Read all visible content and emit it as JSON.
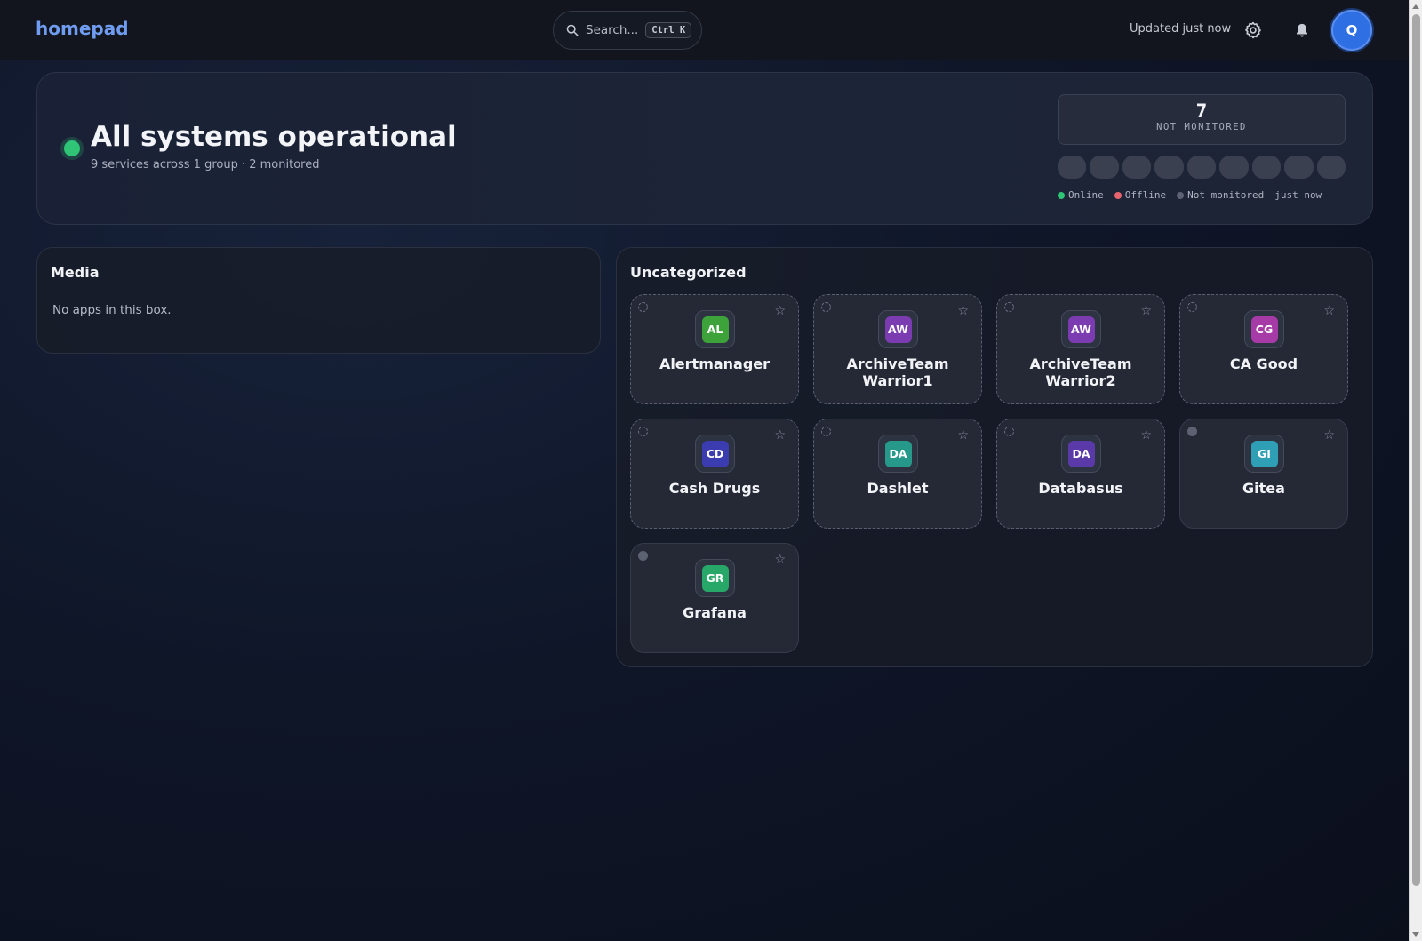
{
  "header": {
    "brand": "homepad",
    "search_placeholder": "Search...",
    "search_shortcut": "Ctrl K",
    "updated_text": "Updated just now",
    "avatar_initial": "Q",
    "accent_color": "#6f9cf0"
  },
  "status": {
    "title": "All systems operational",
    "subtitle": "9 services across 1 group · 2 monitored",
    "not_monitored_count": "7",
    "not_monitored_label": "NOT MONITORED",
    "legend": {
      "online": "Online",
      "offline": "Offline",
      "not_monitored": "Not monitored",
      "time": "just now"
    },
    "colors": {
      "online": "#2fc476",
      "offline": "#e5646e",
      "not_monitored": "#5d6273"
    }
  },
  "boxes": {
    "media": {
      "title": "Media",
      "empty_text": "No apps in this box."
    },
    "uncategorized": {
      "title": "Uncategorized",
      "apps": [
        {
          "initials": "AL",
          "name": "Alertmanager",
          "color": "#3da23a",
          "monitored": false
        },
        {
          "initials": "AW",
          "name": "ArchiveTeam Warrior1",
          "color": "#7a3cb0",
          "monitored": false
        },
        {
          "initials": "AW",
          "name": "ArchiveTeam Warrior2",
          "color": "#7a3cb0",
          "monitored": false
        },
        {
          "initials": "CG",
          "name": "CA Good",
          "color": "#a63aa6",
          "monitored": false
        },
        {
          "initials": "CD",
          "name": "Cash Drugs",
          "color": "#3a3cb0",
          "monitored": false
        },
        {
          "initials": "DA",
          "name": "Dashlet",
          "color": "#27998a",
          "monitored": false
        },
        {
          "initials": "DA",
          "name": "Databasus",
          "color": "#5a3aa8",
          "monitored": false
        },
        {
          "initials": "GI",
          "name": "Gitea",
          "color": "#2f9fb5",
          "monitored": true
        },
        {
          "initials": "GR",
          "name": "Grafana",
          "color": "#27a868",
          "monitored": true
        }
      ]
    }
  }
}
